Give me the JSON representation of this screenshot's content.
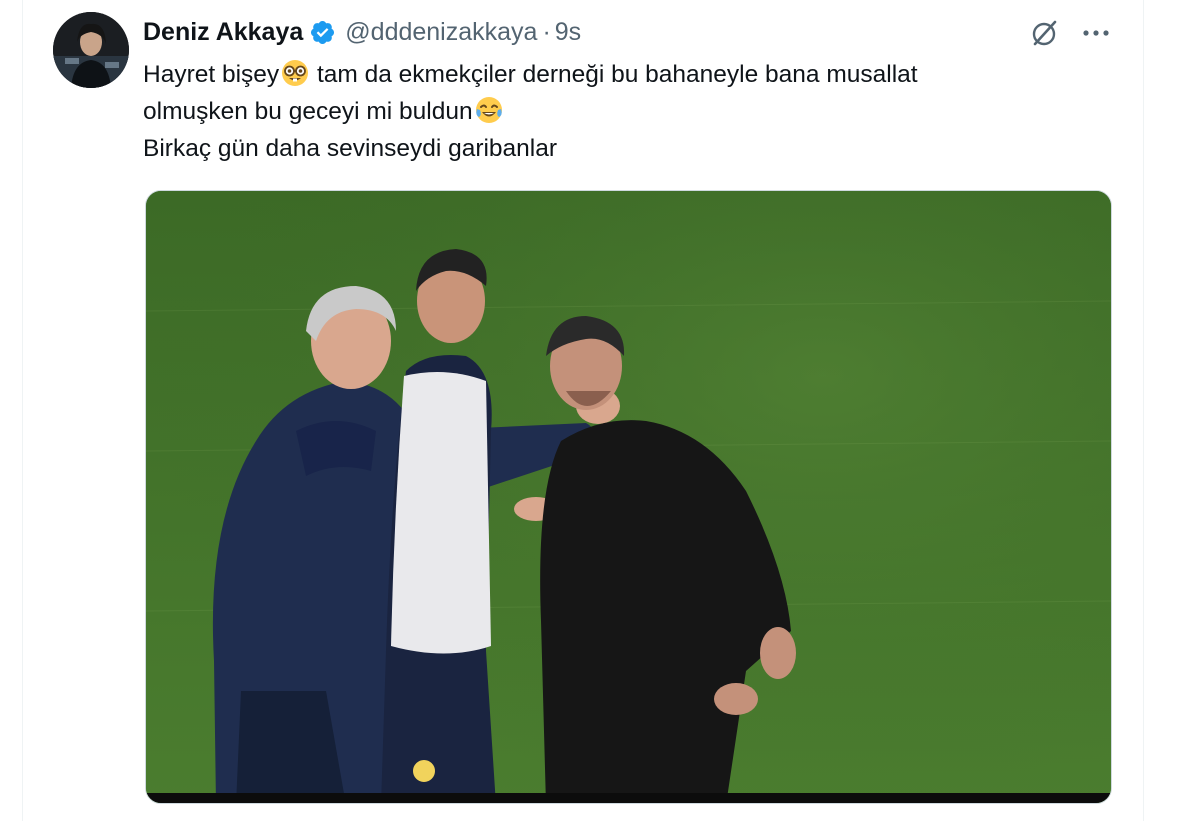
{
  "author": {
    "display_name": "Deniz Akkaya",
    "handle": "@dddenizakkaya",
    "separator": "·",
    "timestamp": "9s",
    "verified_color": "#1d9bf0"
  },
  "tweet": {
    "lines": [
      "Hayret bişey",
      " tam da ekmekçiler derneği bu bahaneyle bana musallat",
      "olmuşken bu geceyi mi buldun",
      "Birkaç gün daha sevinseydi garibanlar"
    ],
    "emojis": [
      "nerd-face-emoji",
      "tears-of-joy-emoji"
    ]
  },
  "icons": {
    "verified": "verified-badge-icon",
    "grok": "grok-icon",
    "more": "more-icon",
    "avatar": "avatar"
  },
  "colors": {
    "text_primary": "#0f1419",
    "text_secondary": "#536471",
    "accent": "#1d9bf0"
  }
}
